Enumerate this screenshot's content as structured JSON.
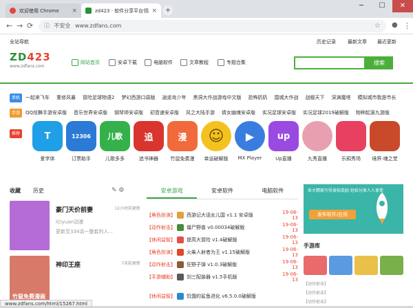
{
  "browser": {
    "tabs": [
      {
        "title": "欢迎使用 Chrome"
      },
      {
        "title": "zd423 · 软件分享平台领跑者"
      }
    ],
    "new_tab_label": "+",
    "window_buttons": [
      "─",
      "☐",
      "✕"
    ],
    "address": {
      "security": "不安全",
      "url": "www.zdfans.com"
    },
    "nav_icons": [
      "back-icon",
      "forward-icon",
      "reload-icon",
      "info-icon",
      "star-icon",
      "avatar-icon",
      "menu-icon"
    ]
  },
  "site": {
    "top_nav": {
      "left": "全站导航",
      "links": [
        "历史记录",
        "最新文章",
        "最近更新"
      ]
    },
    "logo": {
      "text_a": "ZD",
      "text_b": "423",
      "url": "www.zdfans.com"
    },
    "main_nav": [
      "网站首页",
      "安卓下载",
      "电脑软件",
      "文章教程",
      "专题合集"
    ],
    "search": {
      "value": "",
      "button": "搜索"
    },
    "rows": [
      {
        "badge": "单机",
        "badge_color": "#3b8ee8",
        "items": [
          "一起来飞车",
          "重修风暴",
          "冒险足球物语2",
          "梦幻西游口袋版",
          "逍遥岛少年",
          "黑洞大作战游戏中文版",
          "恐怖奶奶",
          "围城大作战",
          "战舰天下",
          "深渊魔塔",
          "模拟城市我是市长"
        ]
      },
      {
        "badge": "手游",
        "badge_color": "#f29a2e",
        "items": [
          "QQ炫舞手游安卓版",
          "音乐世界安卓版",
          "钢琴师安卓版",
          "初音速安卓版",
          "风之大陆手游",
          "倩女幽魂安卓版",
          "实况足球安卓版",
          "实况足球2019破解版",
          "物种起源九游版"
        ]
      }
    ],
    "recommend_badge": "推荐",
    "apps": [
      {
        "name": "爱字体",
        "glyph": "T",
        "color": "#1fa0e6"
      },
      {
        "name": "订票助手",
        "glyph": "12306",
        "color": "#2a7ad6"
      },
      {
        "name": "儿歌多多",
        "glyph": "儿歌",
        "color": "#34b14a"
      },
      {
        "name": "追书神器",
        "glyph": "追",
        "color": "#d8352e"
      },
      {
        "name": "竹鼠免费漫",
        "glyph": "漫",
        "color": "#f06a3c"
      },
      {
        "name": "幸运破解版",
        "glyph": "☺",
        "color": "#f4c21e"
      },
      {
        "name": "MX Player",
        "glyph": "▶",
        "color": "#3a7de0"
      },
      {
        "name": "Up直播",
        "glyph": "up",
        "color": "#9a4ae0"
      },
      {
        "name": "九秀直播",
        "glyph": "",
        "color": "#e8a0b0"
      },
      {
        "name": "乐鸦秀场",
        "glyph": "",
        "color": "#e84060"
      },
      {
        "name": "境界·魂之觉",
        "glyph": "",
        "color": "#c84a2a"
      }
    ],
    "sidebar": {
      "tabs": [
        "收藏",
        "历史"
      ],
      "games": [
        {
          "title": "豪门天价前妻",
          "sub1": "iCiyuan动漫",
          "sub2": "更新至334话一整套的人...",
          "downloads": "12小时前更新",
          "cover": "#b56bd6"
        },
        {
          "title": "神印王座",
          "sub1": "",
          "sub2": "",
          "downloads": "7天前更新",
          "cover": "#d87a6a"
        }
      ],
      "cover_caption": "竹鼠免费漫画"
    },
    "center": {
      "tabs": [
        "安卓游戏",
        "安卓软件",
        "电脑软件"
      ],
      "list": [
        {
          "cat": "【角色扮演】",
          "title": "西游记大话女儿国 v1.1 安卓版",
          "date": "19-06-13",
          "color": "#e0a040"
        },
        {
          "cat": "【动作射击】",
          "title": "僵尸野兽 v0.00034破解版",
          "date": "19-06-13",
          "color": "#4a8a3a"
        },
        {
          "cat": "【休闲益智】",
          "title": "提高大冒险 v1.4破解版",
          "date": "19-06-13",
          "color": "#e05050"
        },
        {
          "cat": "【角色扮演】",
          "title": "火柴人射者为王 v1.15破解版",
          "date": "19-06-13",
          "color": "#d84a2a"
        },
        {
          "cat": "【动作射击】",
          "title": "狂野子弹 v1.0.3破解版",
          "date": "19-06-13",
          "color": "#8a5a3a"
        },
        {
          "cat": "【手游辅助】",
          "title": "剑三配装器 v1.5手机版",
          "date": "19-06-13",
          "color": "#5a5a5a"
        },
        {
          "cat": "【休闲益智】",
          "title": "饥饿的鲨鱼进化 v6.5.0.0破解版",
          "date": "",
          "color": "#2a8ad0"
        }
      ]
    },
    "right": {
      "banner_text": "各大精家引导发帖奖励 轻松分享人人享受",
      "banner_button": "发布软件/应用",
      "section_title": "手游库",
      "lines": [
        "【动作射击】",
        "【动作射击】",
        "【动作射击】"
      ]
    },
    "status_url": "www.zdfans.com/html/15267.html"
  }
}
